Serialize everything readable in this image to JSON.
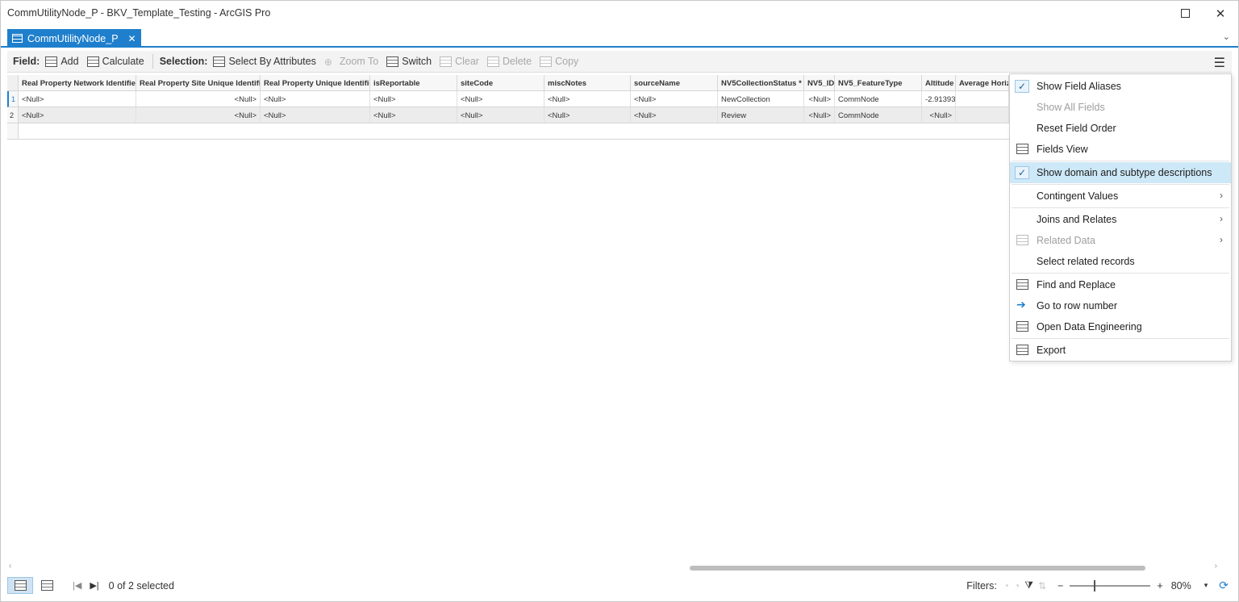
{
  "window": {
    "title": "CommUtilityNode_P - BKV_Template_Testing - ArcGIS Pro"
  },
  "tab": {
    "label": "CommUtilityNode_P"
  },
  "toolbar": {
    "field_label": "Field:",
    "add": "Add",
    "calculate": "Calculate",
    "selection_label": "Selection:",
    "select_by_attributes": "Select By Attributes",
    "zoom_to": "Zoom To",
    "switch": "Switch",
    "clear": "Clear",
    "delete": "Delete",
    "copy": "Copy"
  },
  "table": {
    "columns": [
      "Real Property Network Identifier",
      "Real Property Site Unique Identifier",
      "Real Property Unique Identifier",
      "isReportable",
      "siteCode",
      "miscNotes",
      "sourceName",
      "NV5CollectionStatus *",
      "NV5_ID",
      "NV5_FeatureType",
      "Altitude",
      "Average Horizo"
    ],
    "rows": [
      {
        "num": "1",
        "cells": [
          "<Null>",
          "<Null>",
          "<Null>",
          "<Null>",
          "<Null>",
          "<Null>",
          "<Null>",
          "NewCollection",
          "<Null>",
          "CommNode",
          "-2.91393",
          ""
        ]
      },
      {
        "num": "2",
        "cells": [
          "<Null>",
          "<Null>",
          "<Null>",
          "<Null>",
          "<Null>",
          "<Null>",
          "<Null>",
          "Review",
          "<Null>",
          "CommNode",
          "<Null>",
          ""
        ]
      }
    ]
  },
  "menu": {
    "show_field_aliases": "Show Field Aliases",
    "show_all_fields": "Show All Fields",
    "reset_field_order": "Reset Field Order",
    "fields_view": "Fields View",
    "show_domain": "Show domain and subtype descriptions",
    "contingent_values": "Contingent Values",
    "joins_relates": "Joins and Relates",
    "related_data": "Related Data",
    "select_related": "Select related records",
    "find_replace": "Find and Replace",
    "go_to_row": "Go to row number",
    "open_data_engineering": "Open Data Engineering",
    "export": "Export"
  },
  "status": {
    "selected": "0 of 2 selected",
    "filters_label": "Filters:",
    "zoom": "80%"
  }
}
